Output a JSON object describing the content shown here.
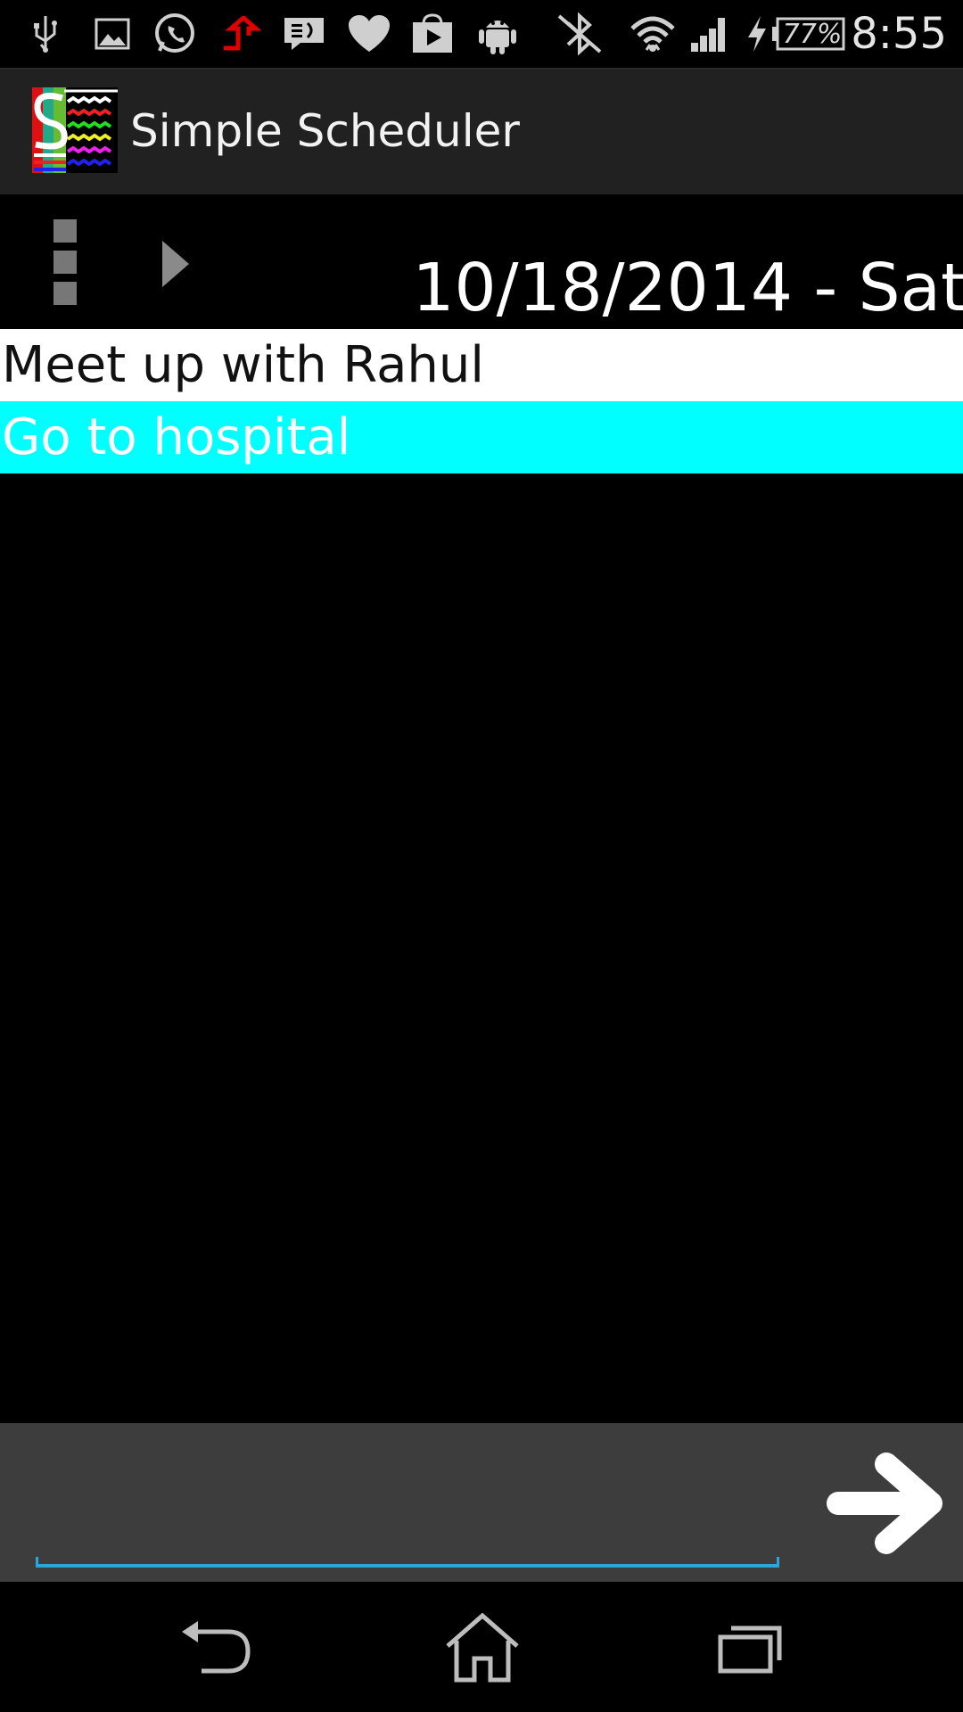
{
  "status_bar": {
    "icons": [
      "usb-icon",
      "gallery-icon",
      "whatsapp-icon",
      "upload-icon",
      "message-icon",
      "heart-icon",
      "play-store-icon",
      "android-icon",
      "bluetooth-off-icon",
      "wifi-icon",
      "signal-icon",
      "charging-icon"
    ],
    "battery": "77%",
    "time": "8:55"
  },
  "action_bar": {
    "title": "Simple Scheduler"
  },
  "toolbar": {
    "date": "10/18/2014 - Sat"
  },
  "tasks": [
    {
      "label": "Meet up with Rahul",
      "highlight": "#ffffff"
    },
    {
      "label": "Go to hospital",
      "highlight": "#00ffff"
    }
  ],
  "input": {
    "value": "",
    "placeholder": ""
  },
  "colors": {
    "accent": "#2aa7d8",
    "selected_row": "#00ffff",
    "action_bar": "#212121",
    "input_bar": "#3d3d3d"
  }
}
